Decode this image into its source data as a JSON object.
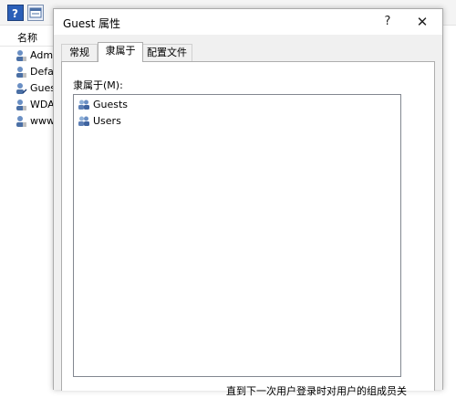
{
  "background": {
    "column_header": "名称",
    "items": [
      {
        "label": "Admi",
        "icon": "user-icon"
      },
      {
        "label": "Defau",
        "icon": "user-icon"
      },
      {
        "label": "Gues",
        "icon": "user-icon"
      },
      {
        "label": "WDA",
        "icon": "user-icon"
      },
      {
        "label": "www.",
        "icon": "user-icon"
      }
    ]
  },
  "dialog": {
    "title": "Guest 属性",
    "help_glyph": "?",
    "close_glyph": "✕",
    "tabs": [
      {
        "label": "常规"
      },
      {
        "label": "隶属于"
      },
      {
        "label": "配置文件"
      }
    ],
    "member_of_label": "隶属于(M):",
    "groups": [
      {
        "label": "Guests",
        "icon": "group-icon"
      },
      {
        "label": "Users",
        "icon": "group-icon"
      }
    ],
    "note": "直到下一次用户登录时对用户的组成员关"
  },
  "colors": {
    "selected_tab_bg": "#ffffff",
    "dialog_bg": "#f0f0f0",
    "listbox_border": "#828790"
  }
}
